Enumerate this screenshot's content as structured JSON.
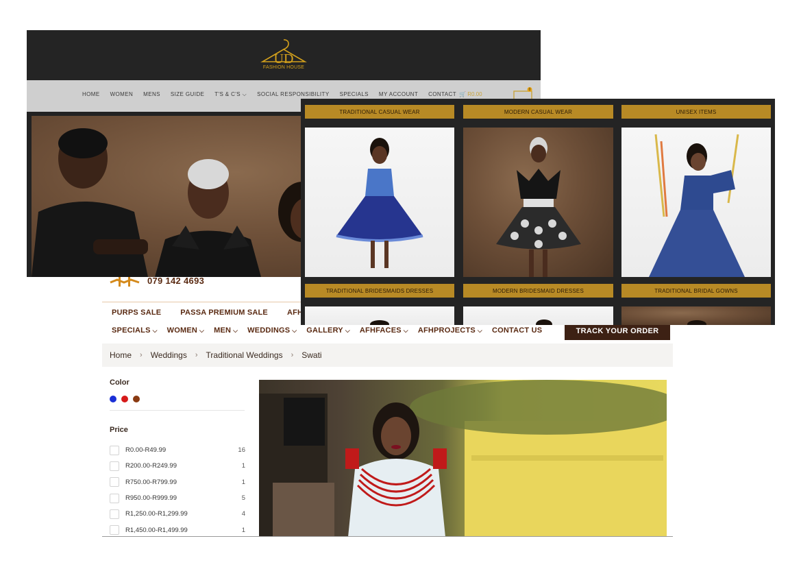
{
  "panel_ud": {
    "logo_text": "FASHION HOUSE",
    "nav": [
      "HOME",
      "WOMEN",
      "MENS",
      "SIZE GUIDE",
      "T'S & C'S",
      "SOCIAL RESPONSIBILITY",
      "SPECIALS",
      "MY ACCOUNT",
      "CONTACT"
    ],
    "cart_total": "R0.00",
    "cart_count": "0",
    "colors": {
      "header_bg": "#242424",
      "nav_bg": "#cfcfcf",
      "gold": "#d4a11c"
    }
  },
  "panel_categories": {
    "items": [
      {
        "label": "TRADITIONAL CASUAL WEAR"
      },
      {
        "label": "MODERN CASUAL WEAR"
      },
      {
        "label": "UNISEX ITEMS"
      },
      {
        "label": "TRADITIONAL BRIDESMAIDS DRESSES"
      },
      {
        "label": "MODERN BRIDESMAID DRESSES"
      },
      {
        "label": "TRADITIONAL BRIDAL GOWNS"
      }
    ],
    "colors": {
      "label_bg": "#b88a25",
      "panel_bg": "#242424"
    }
  },
  "panel_afh": {
    "phone": "079 142 4693",
    "sale_links": [
      "PURPS SALE",
      "PASSA PREMIUM SALE",
      "AFHSE"
    ],
    "nav": [
      {
        "label": "SPECIALS",
        "dropdown": true
      },
      {
        "label": "WOMEN",
        "dropdown": true
      },
      {
        "label": "MEN",
        "dropdown": true
      },
      {
        "label": "WEDDINGS",
        "dropdown": true
      },
      {
        "label": "GALLERY",
        "dropdown": true
      },
      {
        "label": "AFHFACES",
        "dropdown": true
      },
      {
        "label": "AFHPROJECTS",
        "dropdown": true
      },
      {
        "label": "CONTACT US",
        "dropdown": false
      }
    ],
    "track_button": "TRACK YOUR ORDER",
    "breadcrumb": [
      "Home",
      "Weddings",
      "Traditional Weddings",
      "Swati"
    ],
    "filters": {
      "color_title": "Color",
      "color_swatches": [
        "#1a2fd6",
        "#d61a1a",
        "#8a3a12"
      ],
      "price_title": "Price",
      "price_ranges": [
        {
          "label": "R0.00-R49.99",
          "count": "16"
        },
        {
          "label": "R200.00-R249.99",
          "count": "1"
        },
        {
          "label": "R750.00-R799.99",
          "count": "1"
        },
        {
          "label": "R950.00-R999.99",
          "count": "5"
        },
        {
          "label": "R1,250.00-R1,299.99",
          "count": "4"
        },
        {
          "label": "R1,450.00-R1,499.99",
          "count": "1"
        }
      ]
    },
    "colors": {
      "brown": "#5a2a12",
      "track_bg": "#3d2114"
    }
  }
}
